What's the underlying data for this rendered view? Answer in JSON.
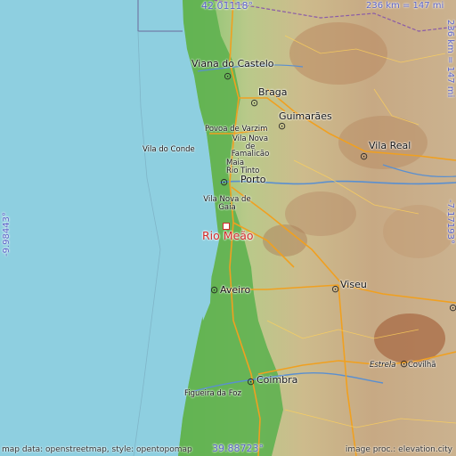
{
  "map": {
    "place": "Rio Meão",
    "lat_top": "42.01118°",
    "lat_bottom": "39.88723°",
    "lon_left": "-9.98443°",
    "lon_right": "-7.17193°",
    "scale_top": "236 km = 147 mi",
    "scale_right": "236 km = 147 mi",
    "attribution_left": "map data: openstreetmap, style: opentopomap",
    "attribution_right": "image proc.: elevation.city",
    "cities": {
      "viana": "Viana do Castelo",
      "braga": "Braga",
      "guimaraes": "Guimarães",
      "povoa": "Povoa de Varzim",
      "vnfamalicao": "Vila Nova de Famalicão",
      "viladoconde": "Vila do Conde",
      "vilareal": "Vila Real",
      "maia": "Maia",
      "riotinto": "Rio Tinto",
      "porto": "Porto",
      "vngaia": "Vila Nova de Gaia",
      "aveiro": "Aveiro",
      "viseu": "Viseu",
      "coimbra": "Coimbra",
      "figueira": "Figueira da Foz",
      "estrela": "Estrela",
      "covilha": "Covilhã"
    },
    "colors": {
      "sea": "#8ecfe0",
      "lowland": "#69b85a",
      "highland": "#c2a883",
      "roads": "#f0a020",
      "place": "#d12a2a",
      "coords": "#5b63c8"
    }
  }
}
